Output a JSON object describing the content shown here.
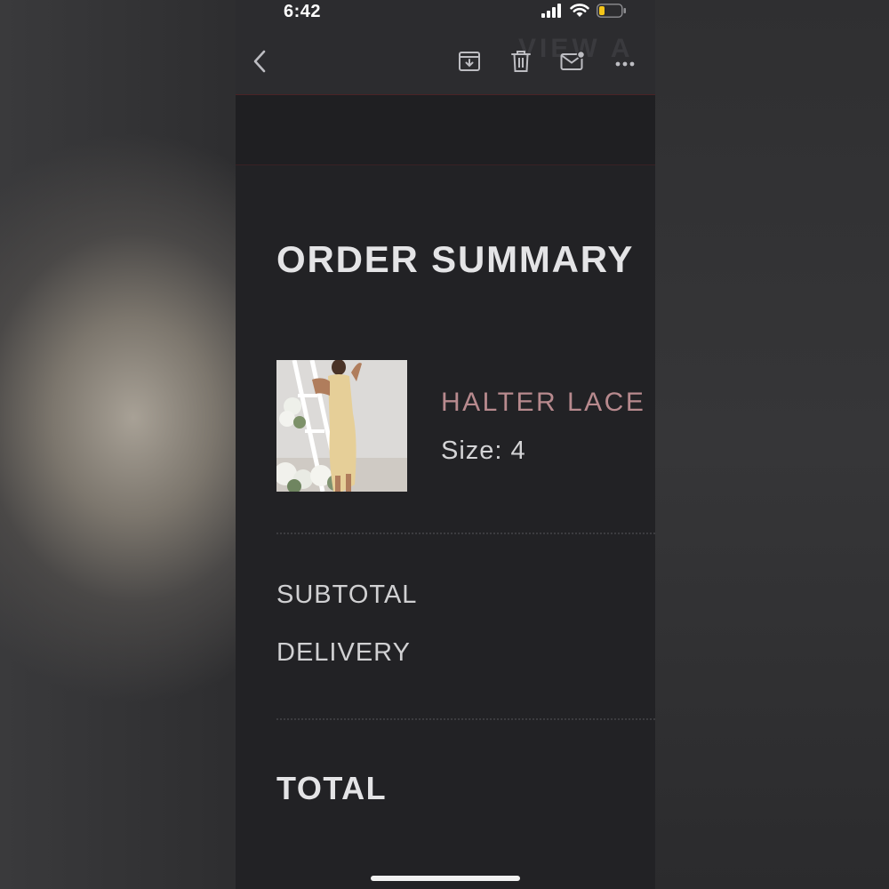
{
  "status_bar": {
    "time": "6:42",
    "icons": [
      "signal-icon",
      "wifi-icon",
      "battery-icon"
    ],
    "battery_color": "#f5c518"
  },
  "toolbar": {
    "back_icon": "chevron-left-icon",
    "actions": [
      "archive-icon",
      "trash-icon",
      "mail-unread-icon",
      "more-icon"
    ],
    "ghost_text": "VIEW A"
  },
  "order": {
    "title": "ORDER SUMMARY",
    "item": {
      "name": "HALTER LACE U",
      "size_label": "Size:",
      "size_value": "4",
      "name_color": "#b88a8e"
    },
    "subtotal_label": "SUBTOTAL",
    "delivery_label": "DELIVERY",
    "total_label": "TOTAL"
  }
}
